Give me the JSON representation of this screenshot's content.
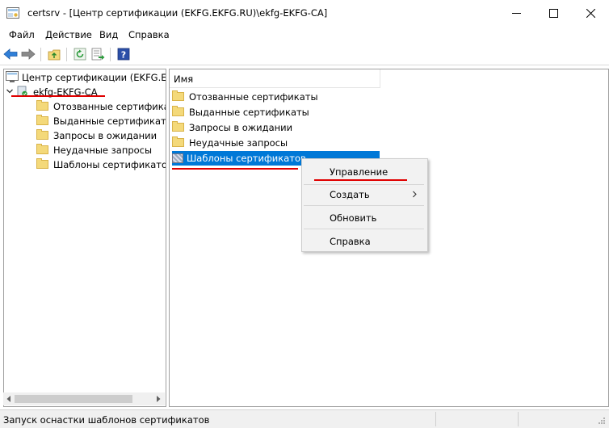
{
  "window": {
    "title": "certsrv - [Центр сертификации (EKFG.EKFG.RU)\\ekfg-EKFG-CA]",
    "app_icon": "certsrv-app-icon",
    "controls": [
      "minimize-icon",
      "maximize-icon",
      "close-icon"
    ]
  },
  "menu": [
    "Файл",
    "Действие",
    "Вид",
    "Справка"
  ],
  "toolbar": {
    "buttons": [
      "back-arrow-icon",
      "forward-arrow-icon",
      "up-folder-icon",
      "refresh-icon",
      "export-list-icon",
      "help-icon"
    ]
  },
  "tree": {
    "root": "Центр сертификации (EKFG.EKFG.RU)",
    "ca": "ekfg-EKFG-CA",
    "items": [
      "Отозванные сертификаты",
      "Выданные сертификаты",
      "Запросы в ожидании",
      "Неудачные запросы",
      "Шаблоны сертификатов"
    ]
  },
  "list": {
    "column": "Имя",
    "items": [
      "Отозванные сертификаты",
      "Выданные сертификаты",
      "Запросы в ожидании",
      "Неудачные запросы",
      "Шаблоны сертификатов"
    ],
    "selected_index": 4
  },
  "context_menu": {
    "items": [
      "Управление",
      "Создать",
      "Обновить",
      "Справка"
    ]
  },
  "status": "Запуск оснастки шаблонов сертификатов",
  "colors": {
    "selection": "#0078d7",
    "annotation_red": "#e00000",
    "folder": "#f4d97a"
  }
}
